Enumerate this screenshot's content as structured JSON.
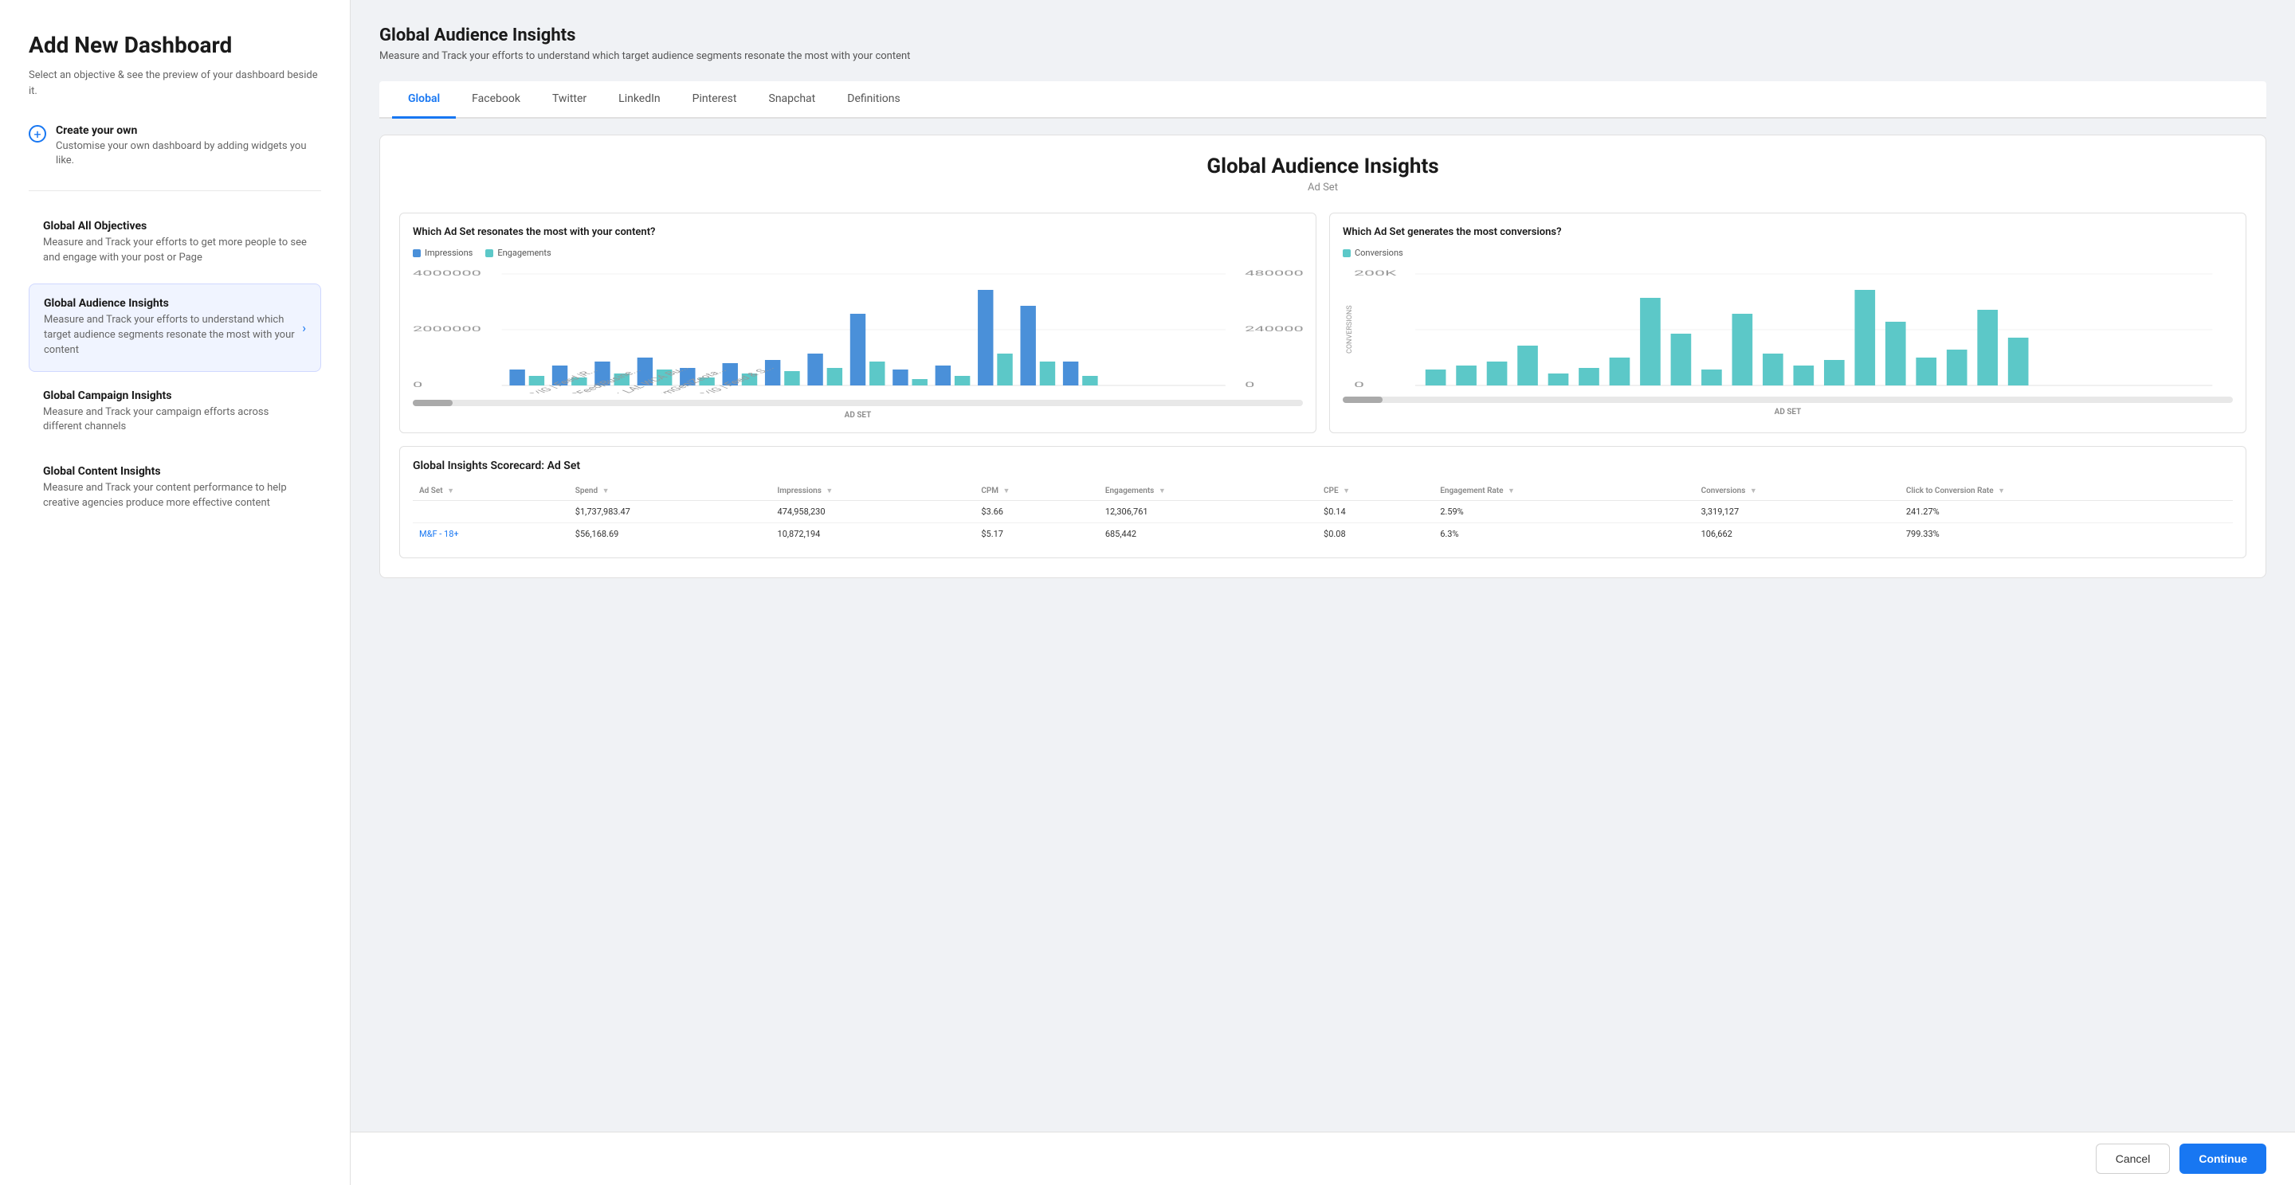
{
  "leftPanel": {
    "title": "Add New Dashboard",
    "subtitle": "Select an objective & see the preview of your dashboard beside it.",
    "createOwn": {
      "label": "Create your own",
      "description": "Customise your own dashboard by adding widgets you like."
    },
    "menuItems": [
      {
        "id": "global-all-objectives",
        "title": "Global All Objectives",
        "description": "Measure and Track your efforts to get more people to see and engage with your post or Page",
        "active": false
      },
      {
        "id": "global-audience-insights",
        "title": "Global Audience Insights",
        "description": "Measure and Track your efforts to understand which target audience segments resonate the most with your content",
        "active": true
      },
      {
        "id": "global-campaign-insights",
        "title": "Global Campaign Insights",
        "description": "Measure and Track your campaign efforts across different channels",
        "active": false
      },
      {
        "id": "global-content-insights",
        "title": "Global Content Insights",
        "description": "Measure and Track your content performance to help creative agencies produce more effective content",
        "active": false
      }
    ]
  },
  "rightPanel": {
    "header": {
      "title": "Global Audience Insights",
      "subtitle": "Measure and Track your efforts to understand which target audience segments resonate the most with your content"
    },
    "tabs": [
      "Global",
      "Facebook",
      "Twitter",
      "LinkedIn",
      "Pinterest",
      "Snapchat",
      "Definitions"
    ],
    "activeTab": "Global",
    "dashboardTitle": "Global Audience Insights",
    "dashboardSubtitle": "Ad Set",
    "chart1": {
      "title": "Which Ad Set resonates the most with your content?",
      "legend": [
        {
          "label": "Impressions",
          "color": "#4a90d9"
        },
        {
          "label": "Engagements",
          "color": "#5cc8c8"
        }
      ],
      "axisLabel": "AD SET",
      "yAxisLeft": [
        "4000000",
        "2000000",
        "0"
      ],
      "yAxisRight": [
        "480000",
        "240000",
        "0"
      ]
    },
    "chart2": {
      "title": "Which Ad Set generates the most conversions?",
      "legend": [
        {
          "label": "Conversions",
          "color": "#5cc8c8"
        }
      ],
      "axisLabel": "AD SET",
      "yAxisLabel": "CONVERSIONS",
      "yValues": [
        "200K",
        "0"
      ]
    },
    "table": {
      "title": "Global Insights Scorecard: Ad Set",
      "columns": [
        "Ad Set",
        "Spend",
        "Impressions",
        "CPM",
        "Engagements",
        "CPE",
        "Engagement Rate",
        "Conversions",
        "Click to Conversion Rate"
      ],
      "totalRow": {
        "adSet": "",
        "spend": "$1,737,983.47",
        "impressions": "474,958,230",
        "cpm": "$3.66",
        "engagements": "12,306,761",
        "cpe": "$0.14",
        "engagementRate": "2.59%",
        "conversions": "3,319,127",
        "clickToConversion": "241.27%"
      },
      "rows": [
        {
          "adSet": "M&F - 18+",
          "spend": "$56,168.69",
          "impressions": "10,872,194",
          "cpm": "$5.17",
          "engagements": "685,442",
          "cpe": "$0.08",
          "engagementRate": "6.3%",
          "conversions": "106,662",
          "clickToConversion": "799.33%"
        }
      ]
    }
  },
  "footer": {
    "cancelLabel": "Cancel",
    "continueLabel": "Continue"
  }
}
